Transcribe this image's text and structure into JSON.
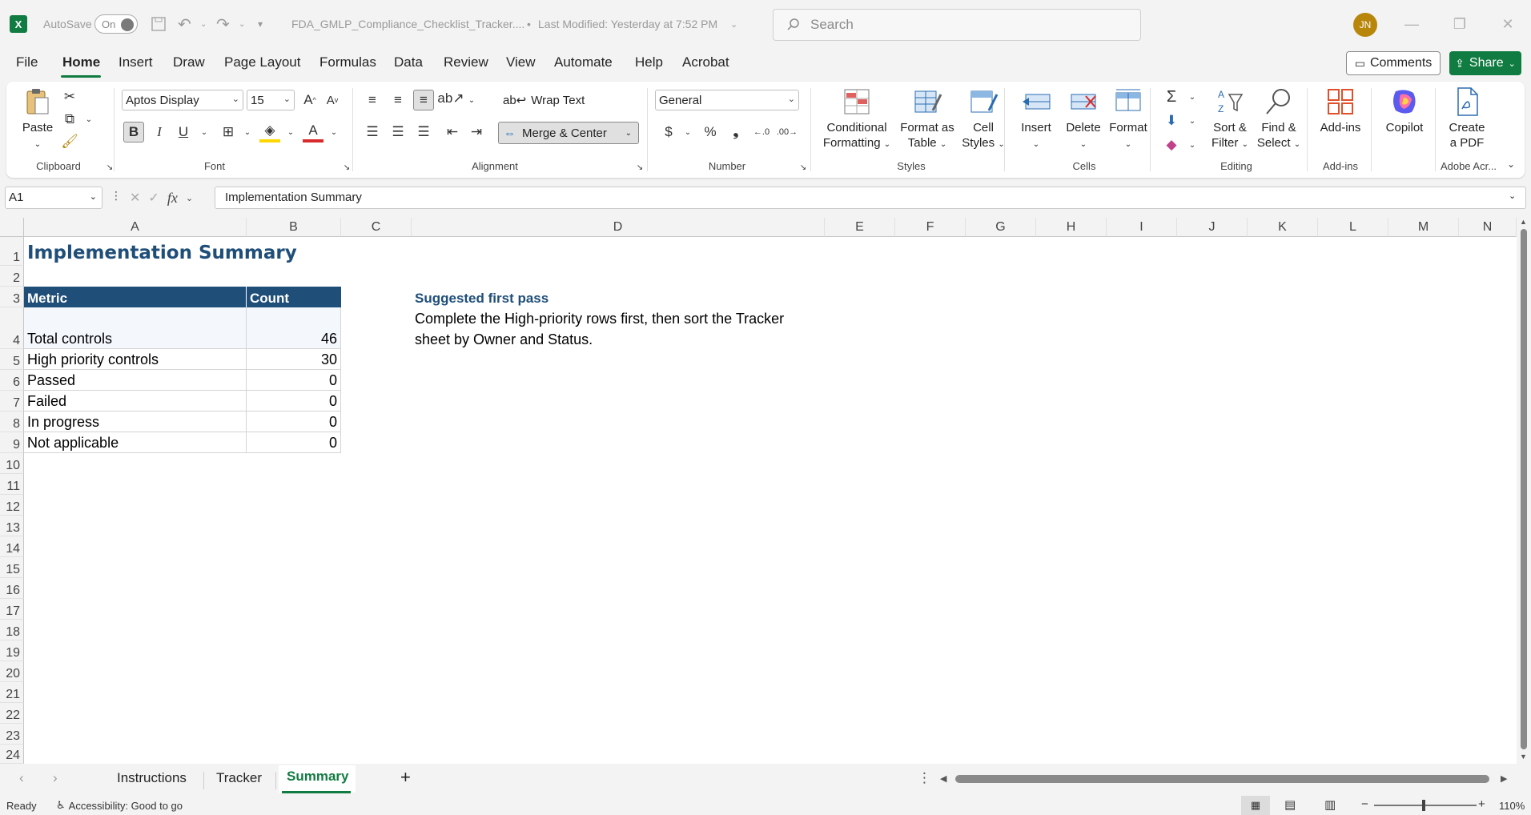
{
  "titlebar": {
    "autosave_label": "AutoSave",
    "autosave_state": "On",
    "filename": "FDA_GMLP_Compliance_Checklist_Tracker....",
    "modified": "Last Modified: Yesterday at 7:52 PM",
    "search_placeholder": "Search",
    "user_initials": "JN"
  },
  "menu": {
    "items": [
      "File",
      "Home",
      "Insert",
      "Draw",
      "Page Layout",
      "Formulas",
      "Data",
      "Review",
      "View",
      "Automate",
      "Help",
      "Acrobat"
    ],
    "active": "Home",
    "comments_label": "Comments",
    "share_label": "Share"
  },
  "ribbon": {
    "clipboard": {
      "paste": "Paste",
      "label": "Clipboard"
    },
    "font": {
      "family": "Aptos Display",
      "size": "15",
      "bold": "B",
      "italic": "I",
      "underline": "U",
      "label": "Font"
    },
    "alignment": {
      "wrap": "Wrap Text",
      "merge": "Merge & Center",
      "label": "Alignment"
    },
    "number": {
      "format": "General",
      "label": "Number"
    },
    "styles": {
      "conditional_1": "Conditional",
      "conditional_2": "Formatting",
      "format_table_1": "Format as",
      "format_table_2": "Table",
      "cell_styles_1": "Cell",
      "cell_styles_2": "Styles",
      "label": "Styles"
    },
    "cells": {
      "insert": "Insert",
      "delete": "Delete",
      "format": "Format",
      "label": "Cells"
    },
    "editing": {
      "sort_1": "Sort &",
      "sort_2": "Filter",
      "find_1": "Find &",
      "find_2": "Select",
      "label": "Editing"
    },
    "addins": {
      "addins": "Add-ins",
      "label": "Add-ins"
    },
    "copilot": {
      "label": "Copilot"
    },
    "adobe": {
      "create_1": "Create",
      "create_2": "a PDF",
      "label": "Adobe Acr..."
    }
  },
  "formula_bar": {
    "name_box": "A1",
    "fx": "fx",
    "content": "Implementation Summary"
  },
  "sheet": {
    "columns": [
      "A",
      "B",
      "C",
      "D",
      "E",
      "F",
      "G",
      "H",
      "I",
      "J",
      "K",
      "L",
      "M",
      "N"
    ],
    "rows": [
      "1",
      "2",
      "3",
      "4",
      "5",
      "6",
      "7",
      "8",
      "9",
      "10",
      "11",
      "12",
      "13",
      "14",
      "15",
      "16",
      "17",
      "18",
      "19",
      "20",
      "21",
      "22",
      "23",
      "24"
    ],
    "title": "Implementation Summary",
    "table_header": {
      "metric": "Metric",
      "count": "Count"
    },
    "table_rows": [
      {
        "metric": "Total controls",
        "count": "46"
      },
      {
        "metric": "High priority controls",
        "count": "30"
      },
      {
        "metric": "Passed",
        "count": "0"
      },
      {
        "metric": "Failed",
        "count": "0"
      },
      {
        "metric": "In progress",
        "count": "0"
      },
      {
        "metric": "Not applicable",
        "count": "0"
      }
    ],
    "note_title": "Suggested first pass",
    "note_line1": "Complete the High-priority rows first, then sort the Tracker",
    "note_line2": "sheet by Owner and Status."
  },
  "tabs": {
    "items": [
      "Instructions",
      "Tracker",
      "Summary"
    ],
    "active": "Summary"
  },
  "status": {
    "ready": "Ready",
    "accessibility": "Accessibility: Good to go",
    "zoom": "110%"
  },
  "colors": {
    "accent": "#107c41",
    "header_fill": "#1f4e79",
    "title_color": "#1f4e79"
  }
}
